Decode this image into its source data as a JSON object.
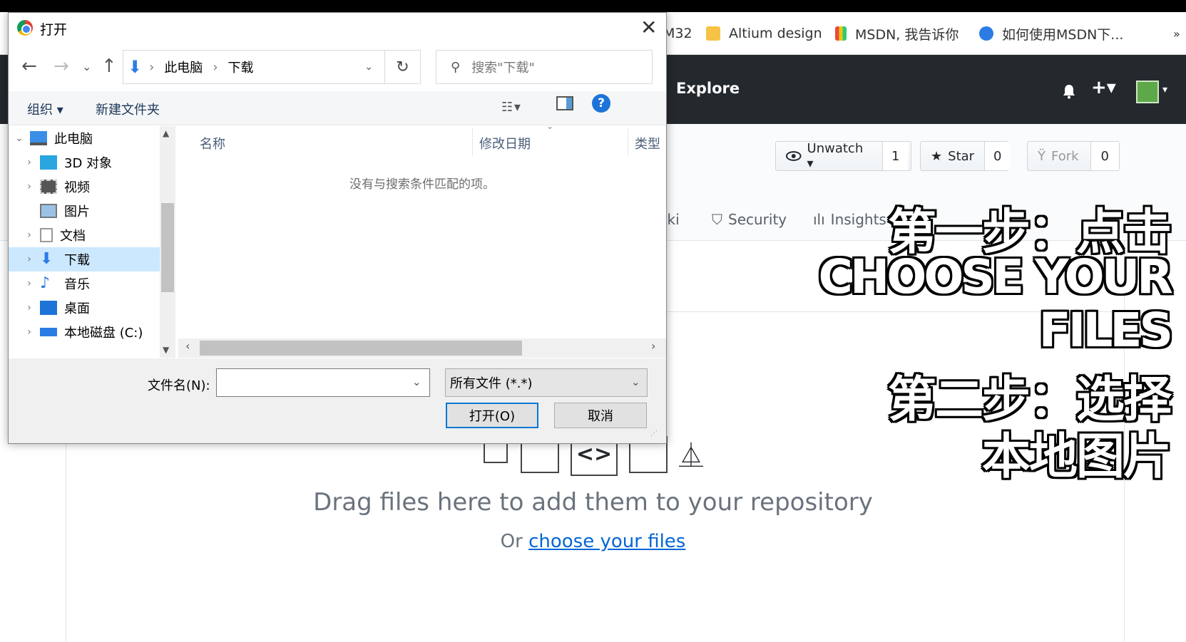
{
  "browser": {
    "bookmarks": [
      {
        "label": "M32",
        "icon": "page-icon"
      },
      {
        "label": "Altium design",
        "icon": "folder-icon"
      },
      {
        "label": "MSDN, 我告诉你",
        "icon": "msdn-icon"
      },
      {
        "label": "如何使用MSDN下...",
        "icon": "paw-icon"
      }
    ],
    "more_label": "»"
  },
  "github": {
    "explore_label": "Explore",
    "plus_label": "+▾",
    "avatar_caret": "▾",
    "unwatch_label": "Unwatch ▾",
    "unwatch_count": "1",
    "star_label": "Star",
    "star_count": "0",
    "fork_label": "Fork",
    "fork_count": "0",
    "tabs": [
      {
        "label": "iki",
        "icon": ""
      },
      {
        "label": "Security",
        "icon": "shield-icon"
      },
      {
        "label": "Insights",
        "icon": "graph-icon"
      }
    ],
    "drag_text": "Drag files here to add them to your repository",
    "choose_prefix": "Or ",
    "choose_link": "choose your files"
  },
  "overlay": {
    "line1": "第一步：点击",
    "line2": "CHOOSE YOUR",
    "line3": "FILES",
    "line4": "第二步：选择",
    "line5": "本地图片"
  },
  "dialog": {
    "title": "打开",
    "close": "✕",
    "nav_back": "←",
    "nav_forward": "→",
    "nav_recent": "⌄",
    "nav_up": "↑",
    "breadcrumb": [
      "此电脑",
      "下载"
    ],
    "refresh": "↻",
    "search_placeholder": "搜索\"下载\"",
    "organize_label": "组织 ▾",
    "new_folder_label": "新建文件夹",
    "help_label": "?",
    "tree": [
      {
        "label": "此电脑",
        "icon": "computer-icon",
        "expanded": true,
        "selected": false
      },
      {
        "label": "3D 对象",
        "icon": "3d-objects-icon",
        "expanded": false,
        "selected": false
      },
      {
        "label": "视频",
        "icon": "video-icon",
        "expanded": false,
        "selected": false
      },
      {
        "label": "图片",
        "icon": "picture-icon",
        "expanded": false,
        "selected": false
      },
      {
        "label": "文档",
        "icon": "document-icon",
        "expanded": false,
        "selected": false
      },
      {
        "label": "下载",
        "icon": "download-icon",
        "expanded": false,
        "selected": true
      },
      {
        "label": "音乐",
        "icon": "music-icon",
        "expanded": false,
        "selected": false
      },
      {
        "label": "桌面",
        "icon": "desktop-icon",
        "expanded": false,
        "selected": false
      },
      {
        "label": "本地磁盘 (C:)",
        "icon": "drive-icon",
        "expanded": false,
        "selected": false
      }
    ],
    "columns": [
      "名称",
      "修改日期",
      "类型"
    ],
    "empty_message": "没有与搜索条件匹配的项。",
    "filename_label": "文件名(N):",
    "filename_value": "",
    "filetype_value": "所有文件 (*.*)",
    "open_label": "打开(O)",
    "cancel_label": "取消"
  }
}
